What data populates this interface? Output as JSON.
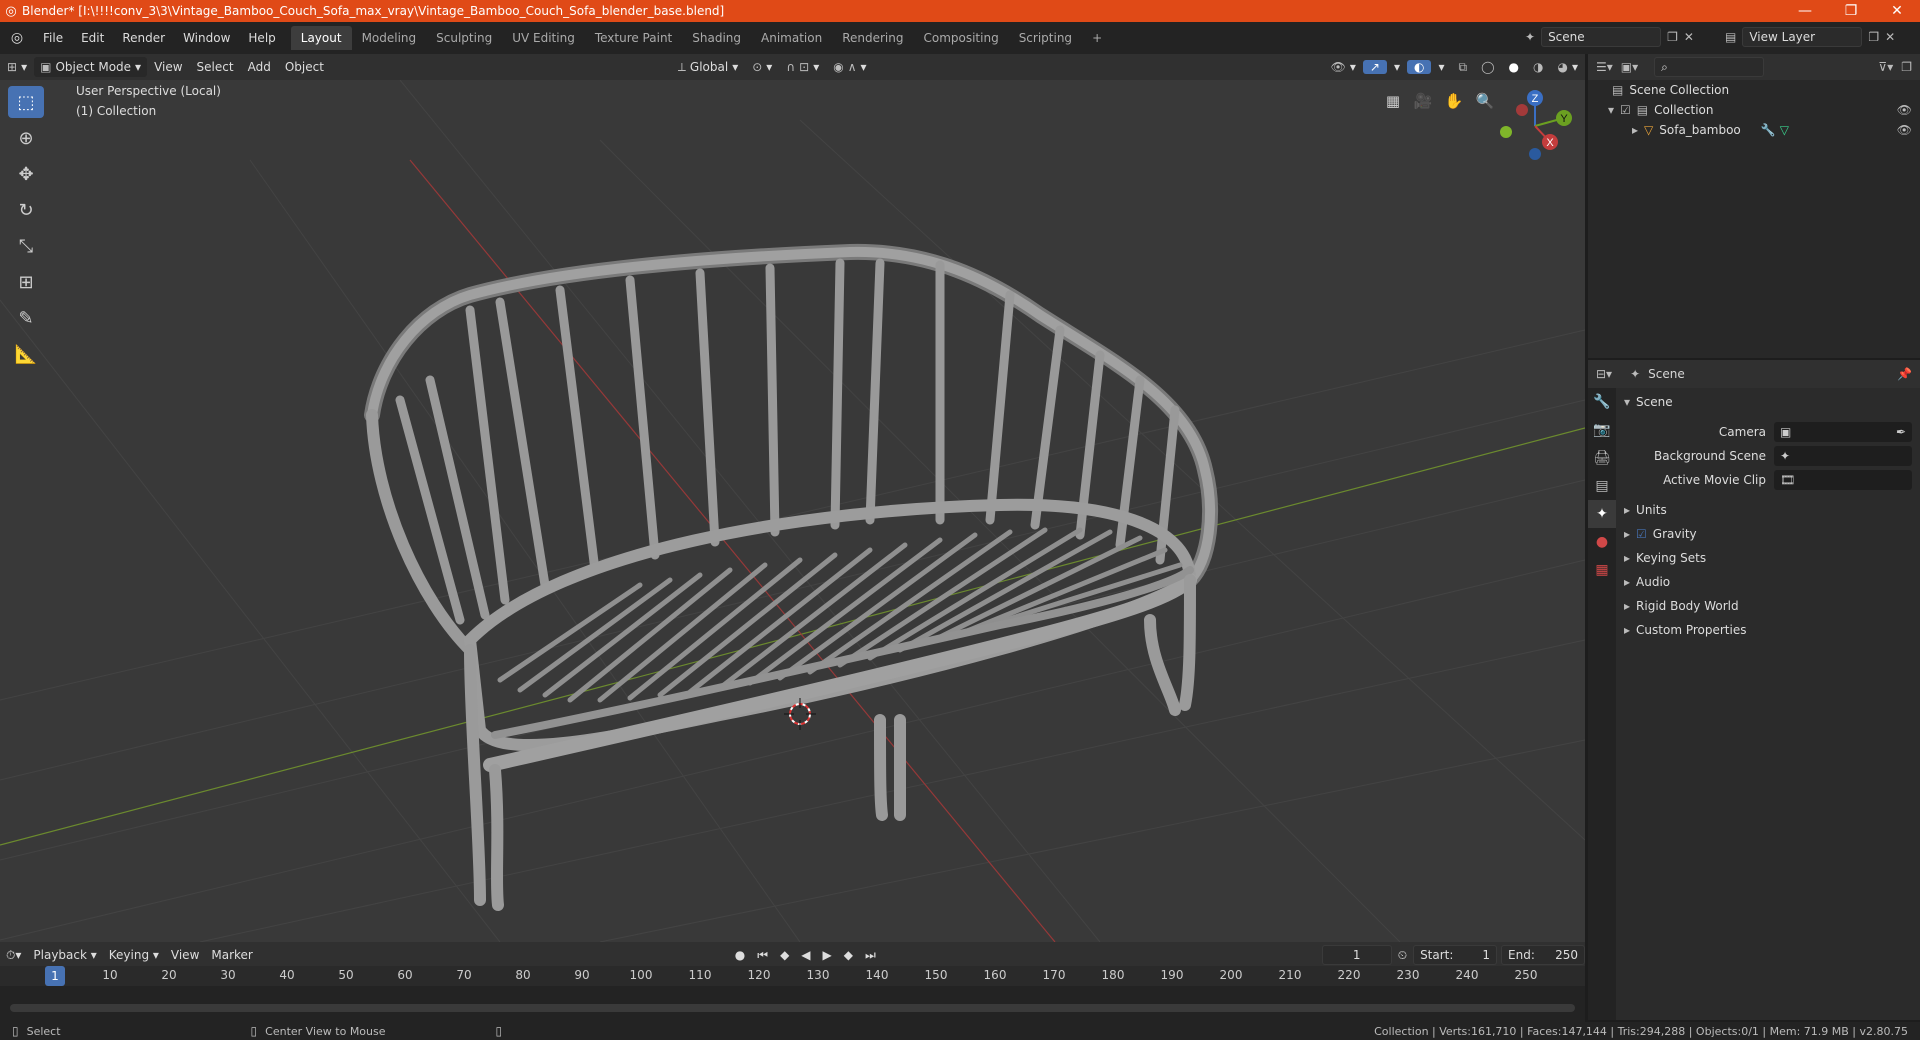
{
  "titlebar": {
    "title": "Blender* [I:\\!!!!conv_3\\3\\Vintage_Bamboo_Couch_Sofa_max_vray\\Vintage_Bamboo_Couch_Sofa_blender_base.blend]",
    "minimize": "—",
    "maximize": "❐",
    "close": "✕"
  },
  "menu": {
    "items": [
      "File",
      "Edit",
      "Render",
      "Window",
      "Help"
    ]
  },
  "workspaces": [
    "Layout",
    "Modeling",
    "Sculpting",
    "UV Editing",
    "Texture Paint",
    "Shading",
    "Animation",
    "Rendering",
    "Compositing",
    "Scripting",
    "+"
  ],
  "scene_field": "Scene",
  "view_layer_field": "View Layer",
  "viewport_header": {
    "mode": "Object Mode",
    "view": "View",
    "select": "Select",
    "add": "Add",
    "object": "Object",
    "orientation": "Global"
  },
  "overlay": {
    "perspective": "User Perspective (Local)",
    "collection": "(1) Collection"
  },
  "gizmo": {
    "z": "Z",
    "y": "Y",
    "x": "X"
  },
  "outliner": {
    "scene_collection": "Scene Collection",
    "collection": "Collection",
    "object": "Sofa_bamboo"
  },
  "properties": {
    "header": "Scene",
    "section": "Scene",
    "camera_label": "Camera",
    "background_label": "Background Scene",
    "movie_clip_label": "Active Movie Clip",
    "panels": [
      "Units",
      "Gravity",
      "Keying Sets",
      "Audio",
      "Rigid Body World",
      "Custom Properties"
    ]
  },
  "timeline": {
    "playback": "Playback",
    "keying": "Keying",
    "view": "View",
    "marker": "Marker",
    "current_frame": "1",
    "start_label": "Start:",
    "start": "1",
    "end_label": "End:",
    "end": "250",
    "ticks": [
      "1",
      "10",
      "20",
      "30",
      "40",
      "50",
      "60",
      "70",
      "80",
      "90",
      "100",
      "110",
      "120",
      "130",
      "140",
      "150",
      "160",
      "170",
      "180",
      "190",
      "200",
      "210",
      "220",
      "230",
      "240",
      "250"
    ]
  },
  "statusbar": {
    "select": "Select",
    "center": "Center View to Mouse",
    "stats": "Collection | Verts:161,710 | Faces:147,144 | Tris:294,288 | Objects:0/1 | Mem: 71.9 MB | v2.80.75"
  }
}
